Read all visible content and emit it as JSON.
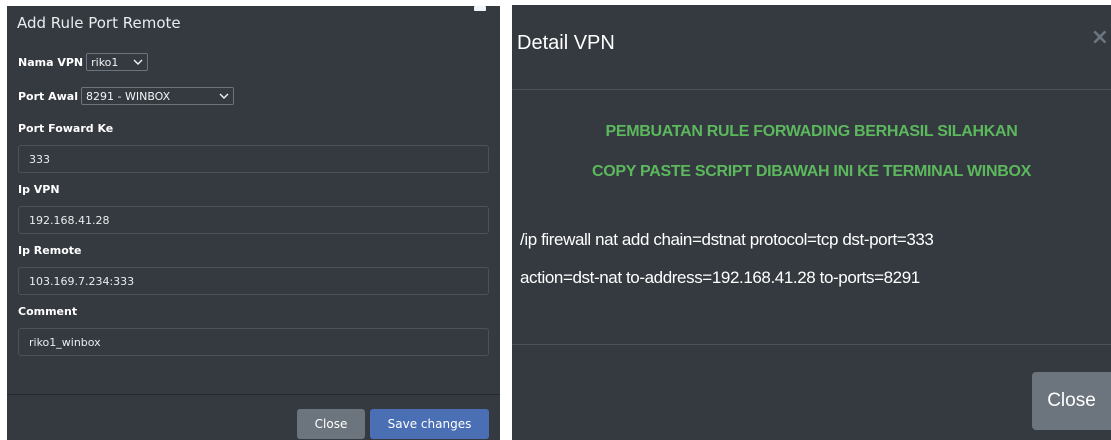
{
  "left_modal": {
    "title": "Add Rule Port Remote",
    "nama_vpn": {
      "label": "Nama VPN",
      "value": "riko1"
    },
    "port_awal": {
      "label": "Port Awal",
      "value": "8291 - WINBOX"
    },
    "port_foward": {
      "label": "Port Foward Ke",
      "value": "333"
    },
    "ip_vpn": {
      "label": "Ip VPN",
      "value": "192.168.41.28"
    },
    "ip_remote": {
      "label": "Ip Remote",
      "value": "103.169.7.234:333"
    },
    "comment": {
      "label": "Comment",
      "value": "riko1_winbox"
    },
    "close_label": "Close",
    "save_label": "Save changes"
  },
  "right_modal": {
    "title": "Detail VPN",
    "close_x": "×",
    "message_line1": "PEMBUATAN RULE FORWADING BERHASIL SILAHKAN",
    "message_line2": "COPY PASTE SCRIPT DIBAWAH INI KE TERMINAL WINBOX",
    "script_line1": "/ip firewall nat add chain=dstnat protocol=tcp dst-port=333",
    "script_line2": "action=dst-nat to-address=192.168.41.28 to-ports=8291",
    "close_label": "Close"
  },
  "colors": {
    "modal_bg": "#343a40",
    "success_text": "#5cb85c",
    "primary_button": "#4a6fb5",
    "secondary_button": "#6c757d"
  }
}
